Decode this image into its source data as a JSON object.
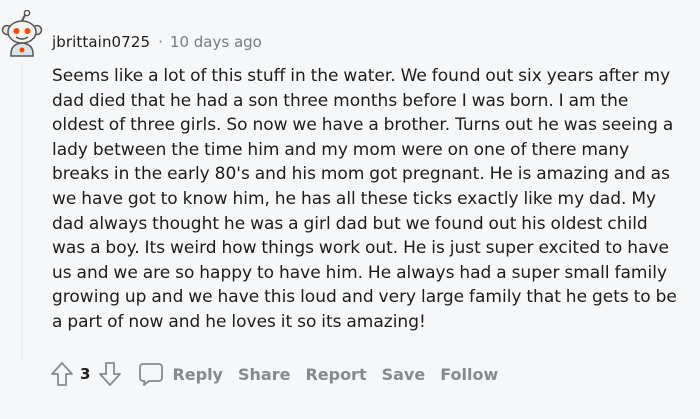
{
  "comment": {
    "author": "jbrittain0725",
    "separator": "·",
    "timestamp": "10 days ago",
    "lines": [
      "Seems like a lot of this stuff in the water. We found out six years after my",
      "dad died that he had a son three months before I was born. I am the",
      "oldest of three girls. So now we have a brother. Turns out he was seeing a",
      "lady between the time him and my mom were on one of there many",
      "breaks in the early 80's and his mom got pregnant. He is amazing and as",
      "we have got to know him, he has all these ticks exactly like my dad. My",
      "dad always thought he was a girl dad but we found out his oldest child",
      "was a boy. Its weird how things work out. He is just super excited to have",
      "us and we are so happy to have him. He always had a super small family",
      "growing up and we have this loud and very large family that he gets to be",
      "a part of now and he loves it so its amazing!"
    ],
    "score": "3"
  },
  "actions": {
    "reply": "Reply",
    "share": "Share",
    "report": "Report",
    "save": "Save",
    "follow": "Follow"
  },
  "icons": {
    "avatar": "reddit-snoo-avatar-icon",
    "upvote": "arrow-up-icon",
    "downvote": "arrow-down-icon",
    "reply": "comment-bubble-icon"
  },
  "colors": {
    "background": "#f6f7f8",
    "text": "#1c1c1c",
    "muted": "#787c7e",
    "action": "#878a8c"
  }
}
